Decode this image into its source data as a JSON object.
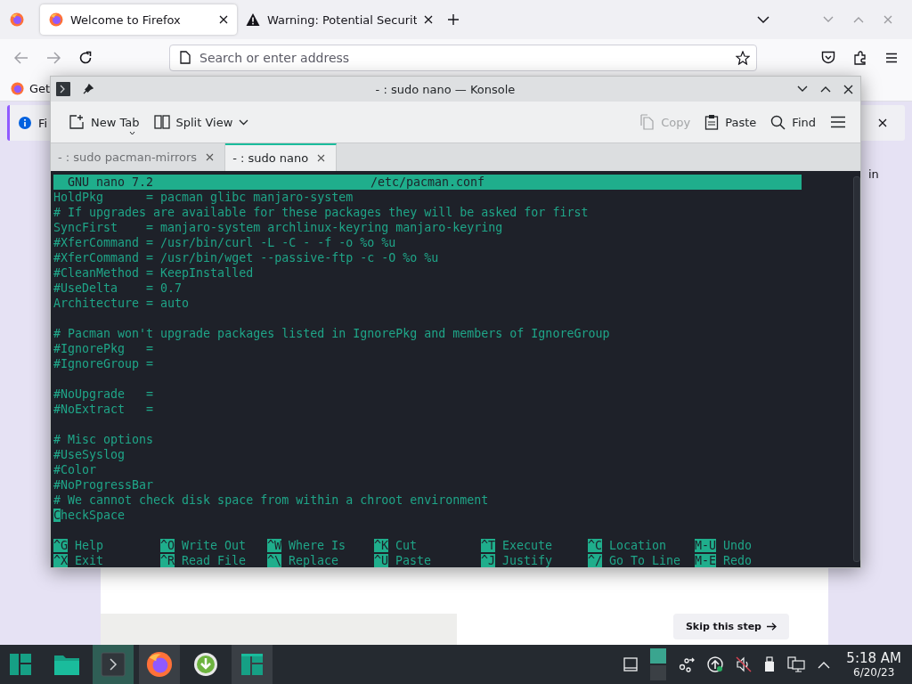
{
  "firefox": {
    "tabs": [
      {
        "title": "Welcome to Firefox",
        "kind": "firefox",
        "selected": true
      },
      {
        "title": "Warning: Potential Securit",
        "kind": "warning",
        "selected": false
      }
    ],
    "address_placeholder": "Search or enter address",
    "bookmarks": [
      "Get"
    ],
    "notification": "Fi",
    "side_text": "in",
    "skip_button": "Skip this step"
  },
  "konsole": {
    "title": "- : sudo nano — Konsole",
    "toolbar": [
      {
        "kind": "new-tab",
        "label": "New Tab",
        "disabled": false
      },
      {
        "kind": "split-view",
        "label": "Split View",
        "disabled": false
      },
      {
        "kind": "copy",
        "label": "Copy",
        "disabled": true
      },
      {
        "kind": "paste",
        "label": "Paste",
        "disabled": false
      },
      {
        "kind": "find",
        "label": "Find",
        "disabled": false
      },
      {
        "kind": "menu",
        "disabled": false
      }
    ],
    "tabs": [
      {
        "label": "- : sudo pacman-mirrors",
        "selected": false
      },
      {
        "label": "- : sudo nano",
        "selected": true
      }
    ],
    "nano": {
      "version": "GNU nano 7.2",
      "file": "/etc/pacman.conf",
      "blocks": [
        [
          {
            "text": "HoldPkg      = pacman glibc manjaro-system",
            "cursor": false
          },
          {
            "text": "# If upgrades are available for these packages they will be asked for first",
            "cursor": false
          },
          {
            "text": "SyncFirst    = manjaro-system archlinux-keyring manjaro-keyring",
            "cursor": false
          },
          {
            "text": "#XferCommand = /usr/bin/curl -L -C - -f -o %o %u",
            "cursor": false
          },
          {
            "text": "#XferCommand = /usr/bin/wget --passive-ftp -c -O %o %u",
            "cursor": false
          },
          {
            "text": "#CleanMethod = KeepInstalled",
            "cursor": false
          },
          {
            "text": "#UseDelta    = 0.7",
            "cursor": false
          },
          {
            "text": "Architecture = auto",
            "cursor": false
          }
        ],
        [
          {
            "text": "# Pacman won't upgrade packages listed in IgnorePkg and members of IgnoreGroup",
            "cursor": false
          },
          {
            "text": "#IgnorePkg   =",
            "cursor": false
          },
          {
            "text": "#IgnoreGroup =",
            "cursor": false
          }
        ],
        [
          {
            "text": "#NoUpgrade   =",
            "cursor": false
          },
          {
            "text": "#NoExtract   =",
            "cursor": false
          }
        ],
        [
          {
            "text": "# Misc options",
            "cursor": false
          },
          {
            "text": "#UseSyslog",
            "cursor": false
          },
          {
            "text": "#Color",
            "cursor": false
          },
          {
            "text": "#NoProgressBar",
            "cursor": false
          },
          {
            "text": "# We cannot check disk space from within a chroot environment",
            "cursor": false
          },
          {
            "text": "CheckSpace",
            "cursor": true
          }
        ]
      ],
      "shortcuts": [
        {
          "key": "^G",
          "label": "Help"
        },
        {
          "key": "^O",
          "label": "Write Out"
        },
        {
          "key": "^W",
          "label": "Where Is"
        },
        {
          "key": "^K",
          "label": "Cut"
        },
        {
          "key": "^T",
          "label": "Execute"
        },
        {
          "key": "^C",
          "label": "Location"
        },
        {
          "key": "M-U",
          "label": "Undo"
        },
        {
          "key": "^X",
          "label": "Exit"
        },
        {
          "key": "^R",
          "label": "Read File"
        },
        {
          "key": "^\\",
          "label": "Replace"
        },
        {
          "key": "^U",
          "label": "Paste"
        },
        {
          "key": "^J",
          "label": "Justify"
        },
        {
          "key": "^/",
          "label": "Go To Line"
        },
        {
          "key": "M-E",
          "label": "Redo"
        }
      ]
    }
  },
  "taskbar": {
    "apps": [
      {
        "kind": "launcher",
        "selected": false,
        "running": false
      },
      {
        "kind": "files",
        "selected": false,
        "running": false
      },
      {
        "kind": "terminal",
        "selected": true,
        "running": true
      },
      {
        "kind": "firefox",
        "selected": false,
        "running": true
      },
      {
        "kind": "installer",
        "selected": false,
        "running": false
      },
      {
        "kind": "welcome",
        "selected": false,
        "running": true
      }
    ],
    "tray": [
      {
        "kind": "window"
      },
      {
        "kind": "pager"
      },
      {
        "kind": "network-share"
      },
      {
        "kind": "updates"
      },
      {
        "kind": "muted-speaker"
      },
      {
        "kind": "usb"
      },
      {
        "kind": "network"
      },
      {
        "kind": "expand"
      }
    ],
    "time": "5:18 AM",
    "date": "6/20/23"
  }
}
